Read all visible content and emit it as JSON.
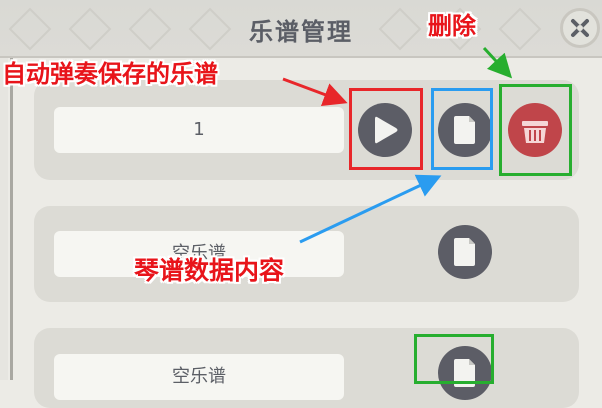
{
  "header": {
    "title": "乐谱管理"
  },
  "cards": [
    {
      "name": "1"
    },
    {
      "name": "空乐谱"
    },
    {
      "name": "空乐谱"
    }
  ],
  "annotations": {
    "autoplay_saved": "自动弹奏保存的乐谱",
    "delete": "删除",
    "score_data": "琴谱数据内容"
  },
  "colors": {
    "annotation_red": "#e8262a",
    "annotation_blue": "#2a9cf0",
    "annotation_green": "#27ae2f",
    "icon_dark": "#5c5d66",
    "delete_red": "#c0454a"
  },
  "icons": {
    "close": "close-icon",
    "play": "play-icon",
    "document": "document-icon",
    "delete": "trash-basket-icon"
  }
}
